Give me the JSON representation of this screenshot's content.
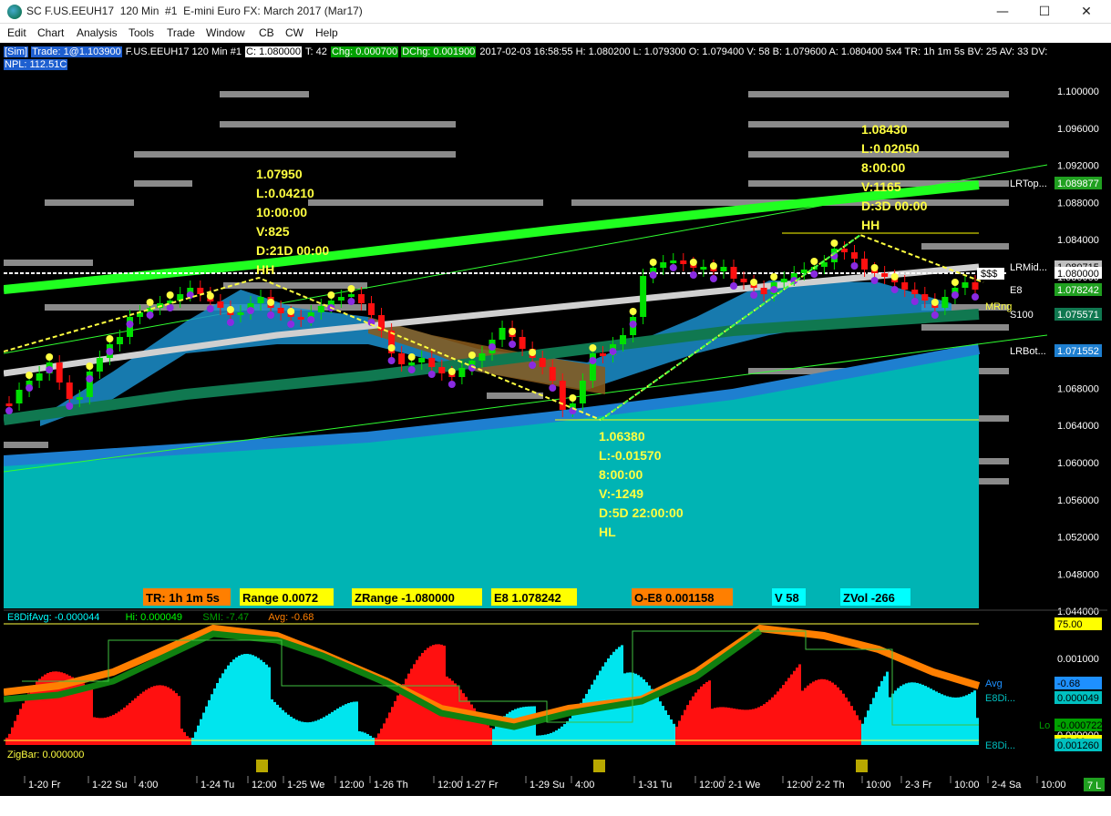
{
  "window": {
    "title": "SC F.US.EEUH17  120 Min  #1  E-mini Euro FX: March 2017 (Mar17)"
  },
  "menu": [
    "Edit",
    "Chart",
    "Analysis",
    "Tools",
    "Trade",
    "Window",
    "CB",
    "CW",
    "Help"
  ],
  "info": {
    "sim": "[Sim]",
    "trade": "Trade: 1@1.103900",
    "symbol": "F.US.EEUH17  120 Min  #1",
    "close": "C: 1.080000",
    "ticks": "T: 42",
    "chg": "Chg: 0.000700",
    "dchg": "DChg: 0.001900",
    "rest": "2017-02-03 16:58:55 H: 1.080200  L: 1.079300  O: 1.079400  V: 58  B: 1.079600  A: 1.080400  5x4  TR: 1h 1m 5s  BV: 25  AV: 33  DV:",
    "npl": "NPL: 112.51C"
  },
  "annotations": {
    "swing1": [
      "1.07950",
      "L:0.04210",
      "10:00:00",
      "V:825",
      "D:21D 00:00",
      "HH"
    ],
    "swing2": [
      "1.06380",
      "L:-0.01570",
      "8:00:00",
      "V:-1249",
      "D:5D 22:00:00",
      "HL"
    ],
    "swing3": [
      "1.08430",
      "L:0.02050",
      "8:00:00",
      "V:1165",
      "D:3D 00:00",
      "HH"
    ]
  },
  "price_axis": [
    "1.100000",
    "1.096000",
    "1.092000",
    "1.088000",
    "1.084000",
    "1.080000",
    "1.076000",
    "1.072000",
    "1.068000",
    "1.064000",
    "1.060000",
    "1.056000",
    "1.052000",
    "1.048000",
    "1.044000"
  ],
  "price_tags": {
    "lrtop": {
      "label": "LRTop...",
      "value": "1.089877"
    },
    "lrmid": {
      "label": "LRMid...",
      "value": "1.080715"
    },
    "cur": {
      "label": "$$$",
      "value": "1.080000"
    },
    "e8": {
      "label": "E8",
      "value": "1.078242"
    },
    "mrng": {
      "label": "MRng"
    },
    "s100": {
      "label": "S100",
      "value": "1.075571"
    },
    "lrbot": {
      "label": "LRBot...",
      "value": "1.071552"
    }
  },
  "bottom_labels": [
    {
      "text": "TR: 1h 1m 5s",
      "bg": "#ff7f00"
    },
    {
      "text": "Range 0.0072",
      "bg": "#ffff00"
    },
    {
      "text": "ZRange -1.080000",
      "bg": "#ffff00"
    },
    {
      "text": "E8 1.078242",
      "bg": "#ffff00"
    },
    {
      "text": "O-E8 0.001158",
      "bg": "#ff7f00"
    },
    {
      "text": "V 58",
      "bg": "#00ffff"
    },
    {
      "text": "ZVol -266",
      "bg": "#00ffff"
    }
  ],
  "subgraph": {
    "header": [
      {
        "text": "E8DifAvg: -0.000044",
        "color": "#00ffff"
      },
      {
        "text": "Hi: 0.000049",
        "color": "#00ff00"
      },
      {
        "text": "SMI: -7.47",
        "color": "#00a000"
      },
      {
        "text": "Avg: -0.68",
        "color": "#ff7f00"
      }
    ],
    "axis": [
      "0.001000",
      "0.000000"
    ],
    "tags": [
      {
        "label": "",
        "value": "75.00",
        "color": "#ffff00"
      },
      {
        "label": "Avg",
        "value": "-0.68",
        "color": "#1e90ff"
      },
      {
        "label": "E8Di...",
        "value": "0.000049",
        "color": "#00c0c0"
      },
      {
        "label": "Lo",
        "value": "-0.000722",
        "color": "#00a000"
      },
      {
        "label": "",
        "value": "-75.00",
        "color": "#ffff00"
      },
      {
        "label": "E8Di...",
        "value": "0.001260",
        "color": "#00c0c0"
      }
    ]
  },
  "zigbar": "ZigBar: 0.000000",
  "time_axis": [
    "1-20 Fr",
    "1-22 Su",
    "4:00",
    "1-24 Tu",
    "12:00",
    "1-25 We",
    "12:00",
    "1-26 Th",
    "12:00",
    "1-27 Fr",
    "1-29 Su",
    "4:00",
    "1-31 Tu",
    "12:00",
    "2-1 We",
    "12:00",
    "2-2 Th",
    "10:00",
    "2-3 Fr",
    "10:00",
    "2-4 Sa",
    "10:00"
  ],
  "corner_tag": "7 L",
  "colors": {
    "up": "#00e000",
    "down": "#ff1010",
    "cyan_area": "#00b4b4",
    "lr_top": "#20ff20",
    "lr_mid": "#d0d0d0",
    "s100": "#107850",
    "lrbot": "#1e7fd0"
  }
}
